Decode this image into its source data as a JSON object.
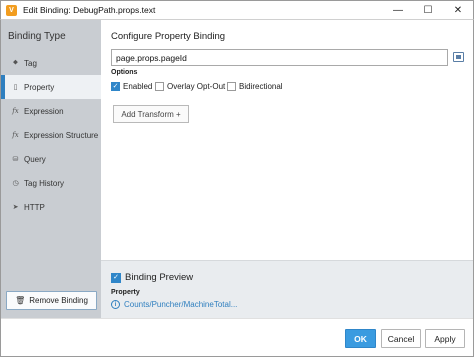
{
  "window": {
    "title": "Edit Binding: DebugPath.props.text",
    "app_icon": "V",
    "minimize": "—",
    "maximize": "☐",
    "close": "✕"
  },
  "sidebar": {
    "header": "Binding Type",
    "items": [
      {
        "label": "Tag",
        "icon": "tag-icon",
        "glyph": "⬥",
        "active": false
      },
      {
        "label": "Property",
        "icon": "property-icon",
        "glyph": "▯",
        "active": true
      },
      {
        "label": "Expression",
        "icon": "fx-icon",
        "glyph": "fx",
        "active": false
      },
      {
        "label": "Expression Structure",
        "icon": "fx-icon",
        "glyph": "fx",
        "active": false
      },
      {
        "label": "Query",
        "icon": "database-icon",
        "glyph": "⛁",
        "active": false
      },
      {
        "label": "Tag History",
        "icon": "history-icon",
        "glyph": "◷",
        "active": false
      },
      {
        "label": "HTTP",
        "icon": "http-icon",
        "glyph": "➤",
        "active": false
      }
    ],
    "remove_button": "Remove Binding"
  },
  "main": {
    "section_title": "Configure Property Binding",
    "property_value": "page.props.pageId",
    "options_label": "Options",
    "options": [
      {
        "label": "Enabled",
        "checked": true
      },
      {
        "label": "Overlay Opt-Out",
        "checked": false
      },
      {
        "label": "Bidirectional",
        "checked": false
      }
    ],
    "add_transform": "Add Transform +"
  },
  "preview": {
    "label": "Binding Preview",
    "checked": true,
    "property_label": "Property",
    "path": "Counts/Puncher/MachineTotal..."
  },
  "footer": {
    "ok": "OK",
    "cancel": "Cancel",
    "apply": "Apply"
  },
  "colors": {
    "accent": "#2f86c9",
    "sidebar_bg": "#c9cdd2",
    "preview_bg": "#e9ecef",
    "app_icon": "#f29d1f"
  }
}
